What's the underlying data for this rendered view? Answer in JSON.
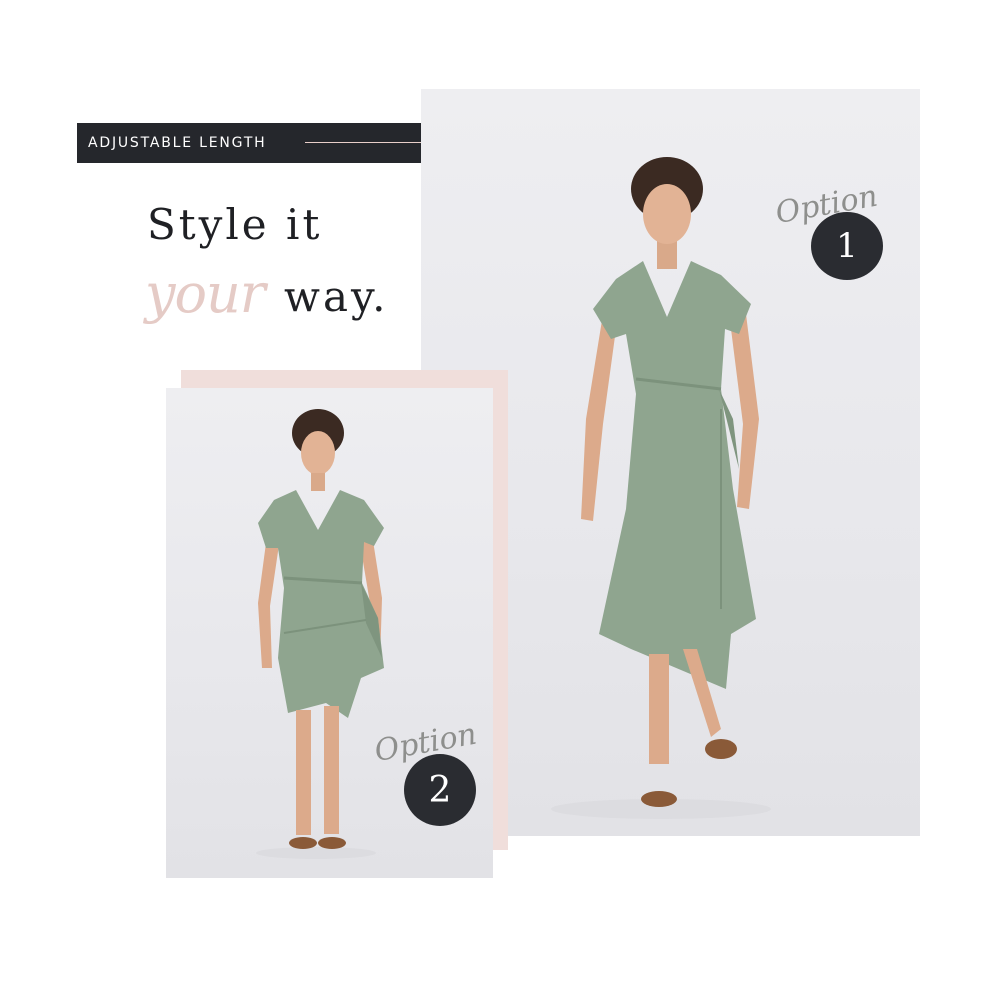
{
  "banner": {
    "label": "ADJUSTABLE LENGTH"
  },
  "headline": {
    "line1": "Style it",
    "script_word": "your",
    "line2_end": "way."
  },
  "options": [
    {
      "script": "Option",
      "number": "1"
    },
    {
      "script": "Option",
      "number": "2"
    }
  ],
  "colors": {
    "banner_bg": "#25272c",
    "accent_pink": "#e5cbc6",
    "frame_pink": "#f0dedb",
    "dress_green": "#8fa58f",
    "badge_bg": "#2a2c31"
  }
}
